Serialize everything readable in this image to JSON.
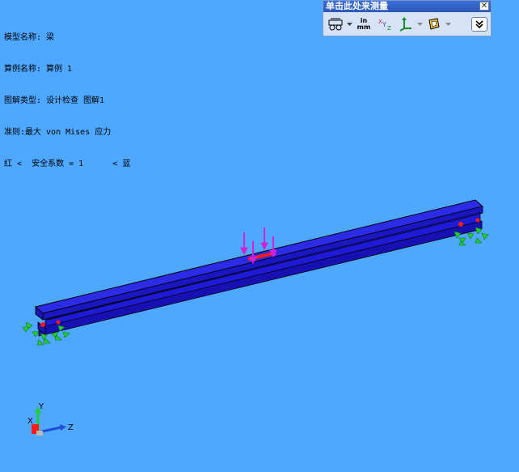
{
  "info": {
    "model_name": "模型名称: 梁",
    "study_name": "算例名称: 算例 1",
    "plot_type": "图解类型: 设计检查 图解1",
    "criterion": "准则:最大 von Mises 应力",
    "legend": "红 <  安全系数 = 1      < 蓝"
  },
  "measure_panel": {
    "title": "单击此处来测量",
    "close_glyph": "✕",
    "units_top": "in",
    "units_bottom": "mm"
  },
  "triad": {
    "x_label": "X",
    "y_label": "Y",
    "z_label": "Z"
  },
  "colors": {
    "background": "#4ea8ff",
    "beam": "#1f1ad8",
    "load_arrow": "#d21fd8",
    "fixture": "#22cc33",
    "stress_red": "#ff1a1a"
  }
}
